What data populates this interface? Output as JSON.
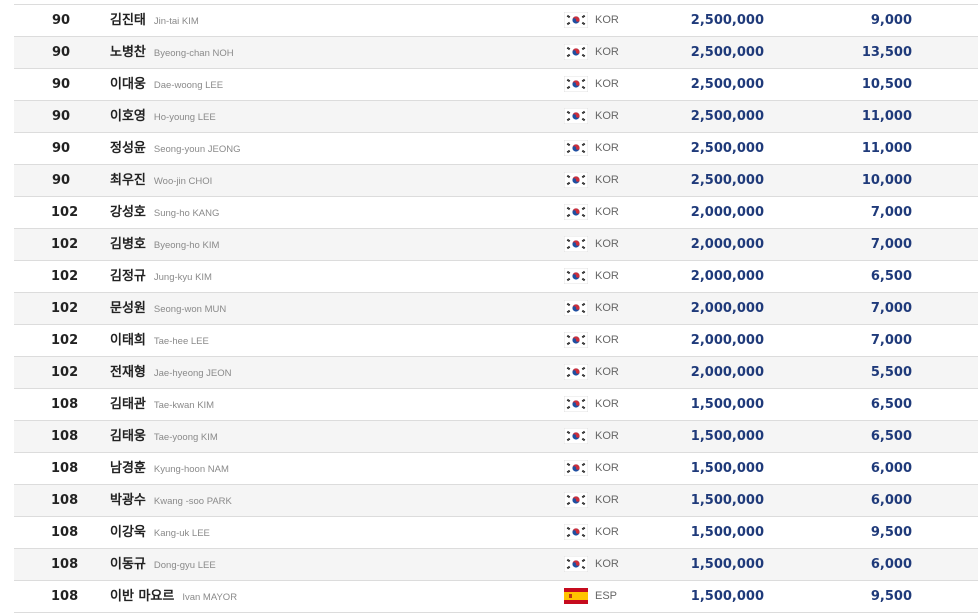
{
  "rankings": {
    "rows": [
      {
        "rank": "90",
        "name_ko": "김진태",
        "name_en": "Jin-tai KIM",
        "country": "KOR",
        "flag": "kr-flag-icon",
        "prize": "2,500,000",
        "points": "9,000"
      },
      {
        "rank": "90",
        "name_ko": "노병찬",
        "name_en": "Byeong-chan NOH",
        "country": "KOR",
        "flag": "kr-flag-icon",
        "prize": "2,500,000",
        "points": "13,500"
      },
      {
        "rank": "90",
        "name_ko": "이대웅",
        "name_en": "Dae-woong LEE",
        "country": "KOR",
        "flag": "kr-flag-icon",
        "prize": "2,500,000",
        "points": "10,500"
      },
      {
        "rank": "90",
        "name_ko": "이호영",
        "name_en": "Ho-young LEE",
        "country": "KOR",
        "flag": "kr-flag-icon",
        "prize": "2,500,000",
        "points": "11,000"
      },
      {
        "rank": "90",
        "name_ko": "정성윤",
        "name_en": "Seong-youn JEONG",
        "country": "KOR",
        "flag": "kr-flag-icon",
        "prize": "2,500,000",
        "points": "11,000"
      },
      {
        "rank": "90",
        "name_ko": "최우진",
        "name_en": "Woo-jin CHOI",
        "country": "KOR",
        "flag": "kr-flag-icon",
        "prize": "2,500,000",
        "points": "10,000"
      },
      {
        "rank": "102",
        "name_ko": "강성호",
        "name_en": "Sung-ho KANG",
        "country": "KOR",
        "flag": "kr-flag-icon",
        "prize": "2,000,000",
        "points": "7,000"
      },
      {
        "rank": "102",
        "name_ko": "김병호",
        "name_en": "Byeong-ho KIM",
        "country": "KOR",
        "flag": "kr-flag-icon",
        "prize": "2,000,000",
        "points": "7,000"
      },
      {
        "rank": "102",
        "name_ko": "김정규",
        "name_en": "Jung-kyu KIM",
        "country": "KOR",
        "flag": "kr-flag-icon",
        "prize": "2,000,000",
        "points": "6,500"
      },
      {
        "rank": "102",
        "name_ko": "문성원",
        "name_en": "Seong-won MUN",
        "country": "KOR",
        "flag": "kr-flag-icon",
        "prize": "2,000,000",
        "points": "7,000"
      },
      {
        "rank": "102",
        "name_ko": "이태희",
        "name_en": "Tae-hee LEE",
        "country": "KOR",
        "flag": "kr-flag-icon",
        "prize": "2,000,000",
        "points": "7,000"
      },
      {
        "rank": "102",
        "name_ko": "전재형",
        "name_en": "Jae-hyeong JEON",
        "country": "KOR",
        "flag": "kr-flag-icon",
        "prize": "2,000,000",
        "points": "5,500"
      },
      {
        "rank": "108",
        "name_ko": "김태관",
        "name_en": "Tae-kwan KIM",
        "country": "KOR",
        "flag": "kr-flag-icon",
        "prize": "1,500,000",
        "points": "6,500"
      },
      {
        "rank": "108",
        "name_ko": "김태웅",
        "name_en": "Tae-yoong KIM",
        "country": "KOR",
        "flag": "kr-flag-icon",
        "prize": "1,500,000",
        "points": "6,500"
      },
      {
        "rank": "108",
        "name_ko": "남경훈",
        "name_en": "Kyung-hoon NAM",
        "country": "KOR",
        "flag": "kr-flag-icon",
        "prize": "1,500,000",
        "points": "6,000"
      },
      {
        "rank": "108",
        "name_ko": "박광수",
        "name_en": "Kwang -soo PARK",
        "country": "KOR",
        "flag": "kr-flag-icon",
        "prize": "1,500,000",
        "points": "6,000"
      },
      {
        "rank": "108",
        "name_ko": "이강욱",
        "name_en": "Kang-uk LEE",
        "country": "KOR",
        "flag": "kr-flag-icon",
        "prize": "1,500,000",
        "points": "9,500"
      },
      {
        "rank": "108",
        "name_ko": "이동규",
        "name_en": "Dong-gyu LEE",
        "country": "KOR",
        "flag": "kr-flag-icon",
        "prize": "1,500,000",
        "points": "6,000"
      },
      {
        "rank": "108",
        "name_ko": "이반 마요르",
        "name_en": "Ivan MAYOR",
        "country": "ESP",
        "flag": "es-flag-icon",
        "prize": "1,500,000",
        "points": "9,500"
      }
    ]
  },
  "colors": {
    "value_text": "#1f3a7a",
    "row_alt": "#f5f5f5",
    "row_border": "#dcdcdc"
  }
}
